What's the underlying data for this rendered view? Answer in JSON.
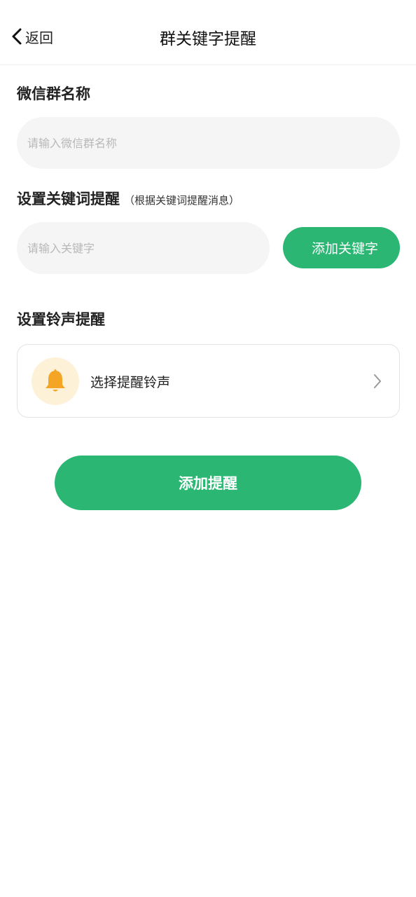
{
  "header": {
    "back_label": "返回",
    "title": "群关键字提醒"
  },
  "group_name": {
    "title": "微信群名称",
    "placeholder": "请输入微信群名称",
    "value": ""
  },
  "keyword": {
    "title": "设置关键词提醒",
    "subtitle": "（根据关键词提醒消息）",
    "placeholder": "请输入关键字",
    "value": "",
    "add_button_label": "添加关键字"
  },
  "ringtone": {
    "title": "设置铃声提醒",
    "select_label": "选择提醒铃声",
    "icon": "bell-icon"
  },
  "submit_button_label": "添加提醒",
  "colors": {
    "accent": "#2bb673",
    "bell_bg": "#fdf1d8",
    "bell": "#f5a524",
    "input_bg": "#f5f5f5"
  }
}
